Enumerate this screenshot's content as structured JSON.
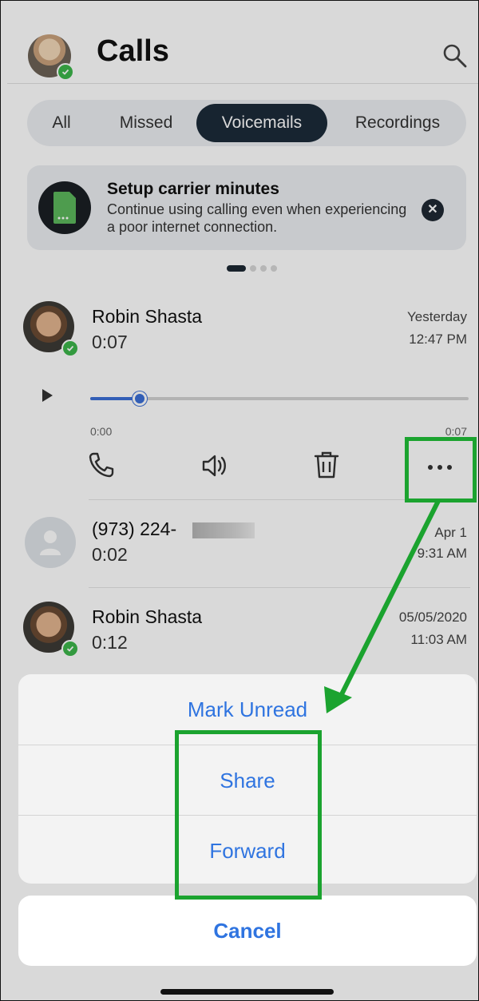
{
  "header": {
    "title": "Calls",
    "status": "online"
  },
  "tabs": [
    {
      "label": "All",
      "active": false
    },
    {
      "label": "Missed",
      "active": false
    },
    {
      "label": "Voicemails",
      "active": true
    },
    {
      "label": "Recordings",
      "active": false
    }
  ],
  "banner": {
    "title": "Setup carrier minutes",
    "body": "Continue using calling even when experiencing a poor internet connection.",
    "page_index": 0,
    "page_count": 4
  },
  "calls": [
    {
      "name": "Robin Shasta",
      "duration": "0:07",
      "date": "Yesterday",
      "time": "12:47 PM",
      "avatar": "photo",
      "online": true
    },
    {
      "name": "(973) 224-",
      "duration": "0:02",
      "date": "Apr 1",
      "time": "9:31 AM",
      "avatar": "person-placeholder-icon",
      "online": false
    },
    {
      "name": "Robin Shasta",
      "duration": "0:12",
      "date": "05/05/2020",
      "time": "11:03 AM",
      "avatar": "photo",
      "online": true
    }
  ],
  "player": {
    "current": "0:00",
    "total": "0:07",
    "progress": 0.13
  },
  "actions": [
    "phone-icon",
    "speaker-icon",
    "trash-icon",
    "more-icon"
  ],
  "sheet": {
    "items": [
      {
        "label": "Mark Unread"
      },
      {
        "label": "Share"
      },
      {
        "label": "Forward"
      }
    ],
    "cancel": "Cancel"
  },
  "colors": {
    "accent": "#2f74e0",
    "annotation": "#1ba32f",
    "active_tab": "#1c2b39",
    "online": "#3cb54a"
  }
}
